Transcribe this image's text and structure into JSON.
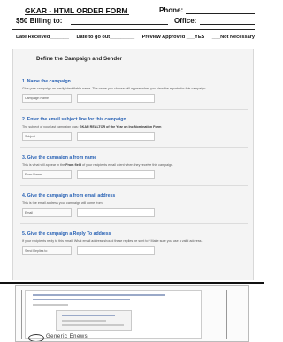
{
  "header": {
    "title": "GKAR - HTML  ORDER  FORM",
    "phone_label": "Phone:",
    "billing_label": "$50 Billing to:",
    "office_label": "Office:"
  },
  "meta": {
    "date_received": "Date Received_______",
    "date_to_go_out": "Date to go out_________",
    "preview_approved": "Preview Approved  ___YES",
    "not_necessary": "___Not Necessary"
  },
  "form": {
    "title": "Define the Campaign and Sender",
    "sections": [
      {
        "heading": "1. Name the campaign",
        "description": "Give your campaign an easily identifiable name. The name you choose will appear when you view the reports for this campaign.",
        "field_label": "Campaign Name"
      },
      {
        "heading": "2. Enter the email subject line for this campaign",
        "description_pre": "The subject of your last campaign was: ",
        "description_bold": "GKAR REALTOR of the Year on Inc Nomination Form",
        "field_label": "Subject"
      },
      {
        "heading": "3. Give the campaign a from name",
        "description_pre": "This is what will appear in the ",
        "description_bold": "From field",
        "description_post": " of your recipients email client when they receive this campaign.",
        "field_label": "From Name"
      },
      {
        "heading": "4. Give the campaign a from email address",
        "description": "This is the email address your campaign will come from.",
        "field_label": "Email"
      },
      {
        "heading": "5. Give the campaign a Reply To address",
        "description": "If your recipients reply to this email. What email address should these replies be sent to? Make sure you use a valid address.",
        "field_label": "Send Replies to"
      }
    ]
  },
  "screenshot": {
    "caption": "Generic Enews"
  }
}
